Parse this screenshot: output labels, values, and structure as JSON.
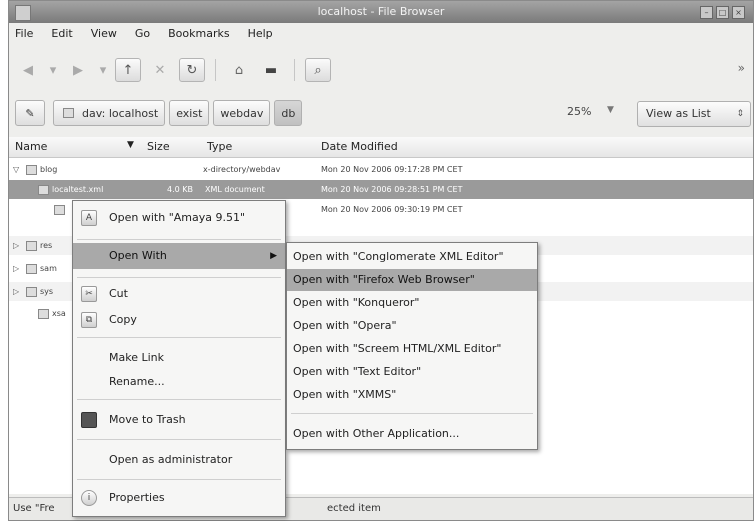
{
  "window": {
    "title": "localhost - File Browser"
  },
  "menubar": [
    "File",
    "Edit",
    "View",
    "Go",
    "Bookmarks",
    "Help"
  ],
  "toolbar": {
    "icons": [
      "back-icon",
      "forward-icon",
      "up-icon",
      "stop-icon",
      "reload-icon",
      "home-icon",
      "computer-icon",
      "search-icon"
    ]
  },
  "location": {
    "buttons": [
      "dav: localhost",
      "exist",
      "webdav",
      "db"
    ],
    "zoom": "25%",
    "view_mode": "View as List"
  },
  "columns": {
    "name": "Name",
    "size": "Size",
    "type": "Type",
    "date": "Date Modified"
  },
  "files": [
    {
      "name": "blog",
      "size": "",
      "type": "x-directory/webdav",
      "date": "Mon 20 Nov 2006 09:17:28 PM CET"
    },
    {
      "name": "localtest.xml",
      "size": "4.0 KB",
      "type": "XML document",
      "date": "Mon 20 Nov 2006 09:28:51 PM CET"
    },
    {
      "name": "",
      "size": "",
      "type": "",
      "date": "Mon 20 Nov 2006 09:30:19 PM CET"
    },
    {
      "name": "res",
      "size": "",
      "type": "",
      "date": ""
    },
    {
      "name": "sam",
      "size": "",
      "type": "",
      "date": ""
    },
    {
      "name": "sys",
      "size": "",
      "type": "",
      "date": ""
    },
    {
      "name": "xsa",
      "size": "",
      "type": "",
      "date": ""
    }
  ],
  "status": {
    "left": "Use \"Fre",
    "right": "ected item"
  },
  "context_menu": {
    "open_with_app": "Open with \"Amaya 9.51\"",
    "open_with": "Open With",
    "cut": "Cut",
    "copy": "Copy",
    "make_link": "Make Link",
    "rename": "Rename...",
    "move_to_trash": "Move to Trash",
    "open_as_admin": "Open as administrator",
    "properties": "Properties"
  },
  "submenu": [
    "Open with \"Conglomerate XML Editor\"",
    "Open with \"Firefox Web Browser\"",
    "Open with \"Konqueror\"",
    "Open with \"Opera\"",
    "Open with \"Screem HTML/XML Editor\"",
    "Open with \"Text Editor\"",
    "Open with \"XMMS\"",
    "Open with Other Application..."
  ]
}
